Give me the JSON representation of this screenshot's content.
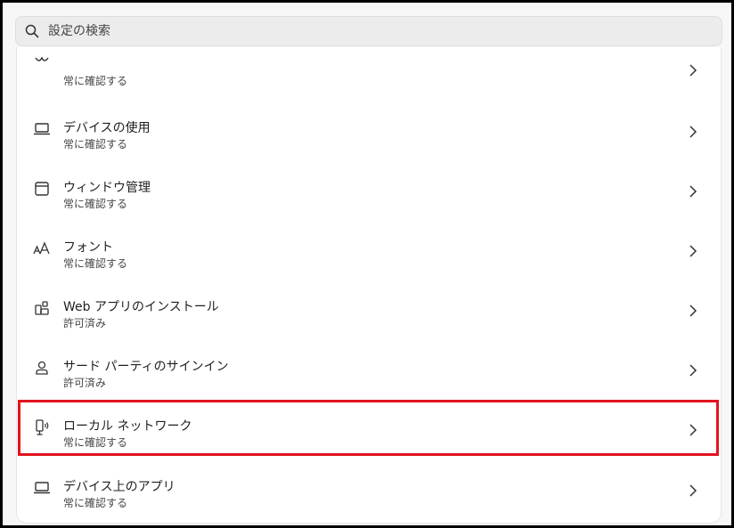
{
  "search": {
    "placeholder": "設定の検索",
    "icon": "search-icon"
  },
  "items": [
    {
      "title": "",
      "subtitle": "常に確認する",
      "icon": "partially-hidden-icon"
    },
    {
      "title": "デバイスの使用",
      "subtitle": "常に確認する",
      "icon": "laptop-icon"
    },
    {
      "title": "ウィンドウ管理",
      "subtitle": "常に確認する",
      "icon": "window-icon"
    },
    {
      "title": "フォント",
      "subtitle": "常に確認する",
      "icon": "font-icon"
    },
    {
      "title": "Web アプリのインストール",
      "subtitle": "許可済み",
      "icon": "app-install-icon"
    },
    {
      "title": "サード パーティのサインイン",
      "subtitle": "許可済み",
      "icon": "person-icon"
    },
    {
      "title": "ローカル ネットワーク",
      "subtitle": "常に確認する",
      "icon": "local-network-icon"
    },
    {
      "title": "デバイス上のアプリ",
      "subtitle": "常に確認する",
      "icon": "laptop-icon"
    }
  ],
  "colors": {
    "highlight": "#e1141e",
    "search_bg": "#ececec"
  }
}
